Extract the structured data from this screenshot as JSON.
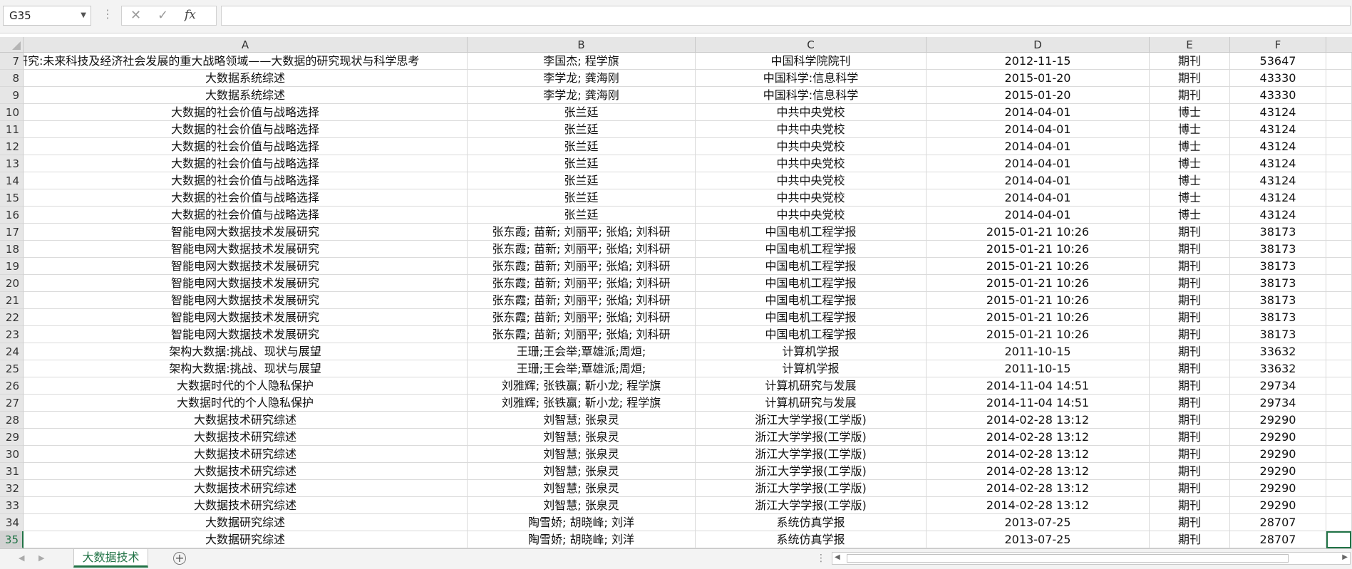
{
  "name_box": {
    "value": "G35"
  },
  "formula_bar": {
    "cancel_icon": "x-icon",
    "enter_icon": "check-icon",
    "fx_label": "fx",
    "value": ""
  },
  "columns": [
    "A",
    "B",
    "C",
    "D",
    "E",
    "F"
  ],
  "rows": [
    {
      "num": "7",
      "cells": [
        "大数据研究:未来科技及经济社会发展的重大战略领域——大数据的研究现状与科学思考",
        "李国杰; 程学旗",
        "中国科学院院刊",
        "2012-11-15",
        "期刊",
        "53647"
      ]
    },
    {
      "num": "8",
      "cells": [
        "大数据系统综述",
        "李学龙; 龚海刚",
        "中国科学:信息科学",
        "2015-01-20",
        "期刊",
        "43330"
      ]
    },
    {
      "num": "9",
      "cells": [
        "大数据系统综述",
        "李学龙; 龚海刚",
        "中国科学:信息科学",
        "2015-01-20",
        "期刊",
        "43330"
      ]
    },
    {
      "num": "10",
      "cells": [
        "大数据的社会价值与战略选择",
        "张兰廷",
        "中共中央党校",
        "2014-04-01",
        "博士",
        "43124"
      ]
    },
    {
      "num": "11",
      "cells": [
        "大数据的社会价值与战略选择",
        "张兰廷",
        "中共中央党校",
        "2014-04-01",
        "博士",
        "43124"
      ]
    },
    {
      "num": "12",
      "cells": [
        "大数据的社会价值与战略选择",
        "张兰廷",
        "中共中央党校",
        "2014-04-01",
        "博士",
        "43124"
      ]
    },
    {
      "num": "13",
      "cells": [
        "大数据的社会价值与战略选择",
        "张兰廷",
        "中共中央党校",
        "2014-04-01",
        "博士",
        "43124"
      ]
    },
    {
      "num": "14",
      "cells": [
        "大数据的社会价值与战略选择",
        "张兰廷",
        "中共中央党校",
        "2014-04-01",
        "博士",
        "43124"
      ]
    },
    {
      "num": "15",
      "cells": [
        "大数据的社会价值与战略选择",
        "张兰廷",
        "中共中央党校",
        "2014-04-01",
        "博士",
        "43124"
      ]
    },
    {
      "num": "16",
      "cells": [
        "大数据的社会价值与战略选择",
        "张兰廷",
        "中共中央党校",
        "2014-04-01",
        "博士",
        "43124"
      ]
    },
    {
      "num": "17",
      "cells": [
        "智能电网大数据技术发展研究",
        "张东霞; 苗新; 刘丽平; 张焰; 刘科研",
        "中国电机工程学报",
        "2015-01-21 10:26",
        "期刊",
        "38173"
      ]
    },
    {
      "num": "18",
      "cells": [
        "智能电网大数据技术发展研究",
        "张东霞; 苗新; 刘丽平; 张焰; 刘科研",
        "中国电机工程学报",
        "2015-01-21 10:26",
        "期刊",
        "38173"
      ]
    },
    {
      "num": "19",
      "cells": [
        "智能电网大数据技术发展研究",
        "张东霞; 苗新; 刘丽平; 张焰; 刘科研",
        "中国电机工程学报",
        "2015-01-21 10:26",
        "期刊",
        "38173"
      ]
    },
    {
      "num": "20",
      "cells": [
        "智能电网大数据技术发展研究",
        "张东霞; 苗新; 刘丽平; 张焰; 刘科研",
        "中国电机工程学报",
        "2015-01-21 10:26",
        "期刊",
        "38173"
      ]
    },
    {
      "num": "21",
      "cells": [
        "智能电网大数据技术发展研究",
        "张东霞; 苗新; 刘丽平; 张焰; 刘科研",
        "中国电机工程学报",
        "2015-01-21 10:26",
        "期刊",
        "38173"
      ]
    },
    {
      "num": "22",
      "cells": [
        "智能电网大数据技术发展研究",
        "张东霞; 苗新; 刘丽平; 张焰; 刘科研",
        "中国电机工程学报",
        "2015-01-21 10:26",
        "期刊",
        "38173"
      ]
    },
    {
      "num": "23",
      "cells": [
        "智能电网大数据技术发展研究",
        "张东霞; 苗新; 刘丽平; 张焰; 刘科研",
        "中国电机工程学报",
        "2015-01-21 10:26",
        "期刊",
        "38173"
      ]
    },
    {
      "num": "24",
      "cells": [
        "架构大数据:挑战、现状与展望",
        "王珊;王会举;覃雄派;周烜;",
        "计算机学报",
        "2011-10-15",
        "期刊",
        "33632"
      ]
    },
    {
      "num": "25",
      "cells": [
        "架构大数据:挑战、现状与展望",
        "王珊;王会举;覃雄派;周烜;",
        "计算机学报",
        "2011-10-15",
        "期刊",
        "33632"
      ]
    },
    {
      "num": "26",
      "cells": [
        "大数据时代的个人隐私保护",
        "刘雅辉; 张铁赢; 靳小龙; 程学旗",
        "计算机研究与发展",
        "2014-11-04 14:51",
        "期刊",
        "29734"
      ]
    },
    {
      "num": "27",
      "cells": [
        "大数据时代的个人隐私保护",
        "刘雅辉; 张铁赢; 靳小龙; 程学旗",
        "计算机研究与发展",
        "2014-11-04 14:51",
        "期刊",
        "29734"
      ]
    },
    {
      "num": "28",
      "cells": [
        "大数据技术研究综述",
        "刘智慧; 张泉灵",
        "浙江大学学报(工学版)",
        "2014-02-28 13:12",
        "期刊",
        "29290"
      ]
    },
    {
      "num": "29",
      "cells": [
        "大数据技术研究综述",
        "刘智慧; 张泉灵",
        "浙江大学学报(工学版)",
        "2014-02-28 13:12",
        "期刊",
        "29290"
      ]
    },
    {
      "num": "30",
      "cells": [
        "大数据技术研究综述",
        "刘智慧; 张泉灵",
        "浙江大学学报(工学版)",
        "2014-02-28 13:12",
        "期刊",
        "29290"
      ]
    },
    {
      "num": "31",
      "cells": [
        "大数据技术研究综述",
        "刘智慧; 张泉灵",
        "浙江大学学报(工学版)",
        "2014-02-28 13:12",
        "期刊",
        "29290"
      ]
    },
    {
      "num": "32",
      "cells": [
        "大数据技术研究综述",
        "刘智慧; 张泉灵",
        "浙江大学学报(工学版)",
        "2014-02-28 13:12",
        "期刊",
        "29290"
      ]
    },
    {
      "num": "33",
      "cells": [
        "大数据技术研究综述",
        "刘智慧; 张泉灵",
        "浙江大学学报(工学版)",
        "2014-02-28 13:12",
        "期刊",
        "29290"
      ]
    },
    {
      "num": "34",
      "cells": [
        "大数据研究综述",
        "陶雪娇; 胡晓峰; 刘洋",
        "系统仿真学报",
        "2013-07-25",
        "期刊",
        "28707"
      ]
    },
    {
      "num": "35",
      "cells": [
        "大数据研究综述",
        "陶雪娇; 胡晓峰; 刘洋",
        "系统仿真学报",
        "2013-07-25",
        "期刊",
        "28707"
      ]
    }
  ],
  "active_row": "35",
  "sheet_tabs": [
    "大数据技术"
  ],
  "accent_color": "#217346"
}
